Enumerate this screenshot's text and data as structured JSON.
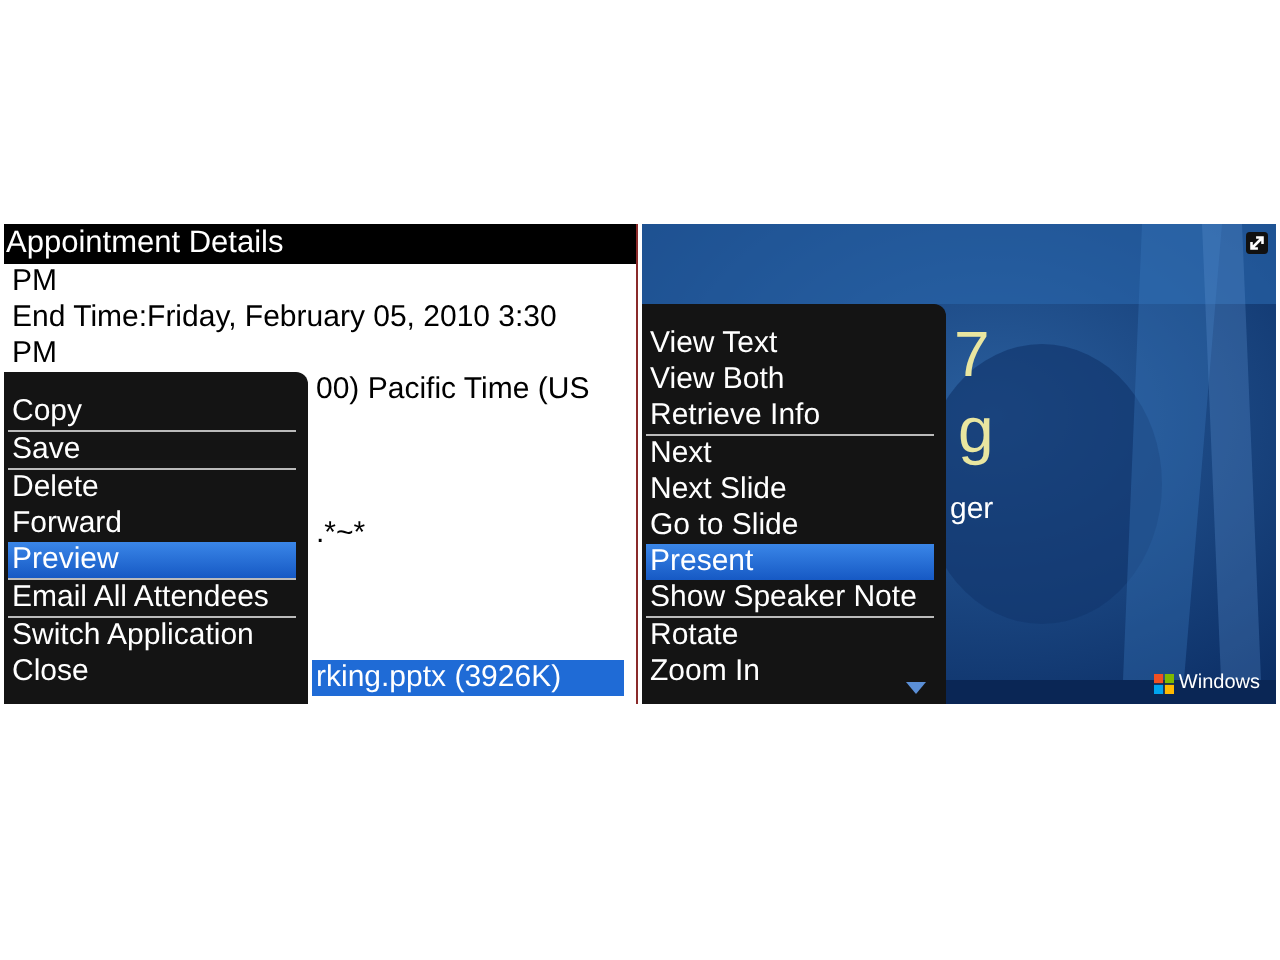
{
  "left_screen": {
    "title": "Appointment Details",
    "lines": [
      {
        "text": "PM",
        "kind": "line",
        "selected": false
      },
      {
        "text": "End Time:Friday, February 05, 2010 3:30",
        "kind": "line",
        "selected": false
      },
      {
        "text": "PM",
        "kind": "line",
        "selected": false
      },
      {
        "text": "00) Pacific Time (US",
        "kind": "clipped",
        "selected": false
      },
      {
        "text": ".*~*",
        "kind": "clipped_after_gap",
        "selected": false
      },
      {
        "text": "rking.pptx (3926K)",
        "kind": "clipped_after_gap",
        "selected": true
      }
    ],
    "menu": [
      {
        "label": "Copy",
        "selected": false,
        "divider_after": true
      },
      {
        "label": "Save",
        "selected": false,
        "divider_after": true
      },
      {
        "label": "Delete",
        "selected": false,
        "divider_after": false
      },
      {
        "label": "Forward",
        "selected": false,
        "divider_after": false
      },
      {
        "label": "Preview",
        "selected": true,
        "divider_after": true
      },
      {
        "label": "Email All Attendees",
        "selected": false,
        "divider_after": true
      },
      {
        "label": "Switch Application",
        "selected": false,
        "divider_after": false
      },
      {
        "label": "Close",
        "selected": false,
        "divider_after": false
      }
    ]
  },
  "right_screen": {
    "slide": {
      "title_fragments": [
        "7",
        "g"
      ],
      "subtitle_fragment": "ger",
      "logo_text": "Windows"
    },
    "menu": [
      {
        "label": "View Text",
        "selected": false,
        "divider_after": false
      },
      {
        "label": "View Both",
        "selected": false,
        "divider_after": false
      },
      {
        "label": "Retrieve Info",
        "selected": false,
        "divider_after": true
      },
      {
        "label": "Next",
        "selected": false,
        "divider_after": false
      },
      {
        "label": "Next Slide",
        "selected": false,
        "divider_after": false
      },
      {
        "label": "Go to Slide",
        "selected": false,
        "divider_after": false
      },
      {
        "label": "Present",
        "selected": true,
        "divider_after": false
      },
      {
        "label": "Show Speaker Note",
        "selected": false,
        "divider_after": true
      },
      {
        "label": "Rotate",
        "selected": false,
        "divider_after": false
      },
      {
        "label": "Zoom In",
        "selected": false,
        "divider_after": false
      }
    ]
  }
}
